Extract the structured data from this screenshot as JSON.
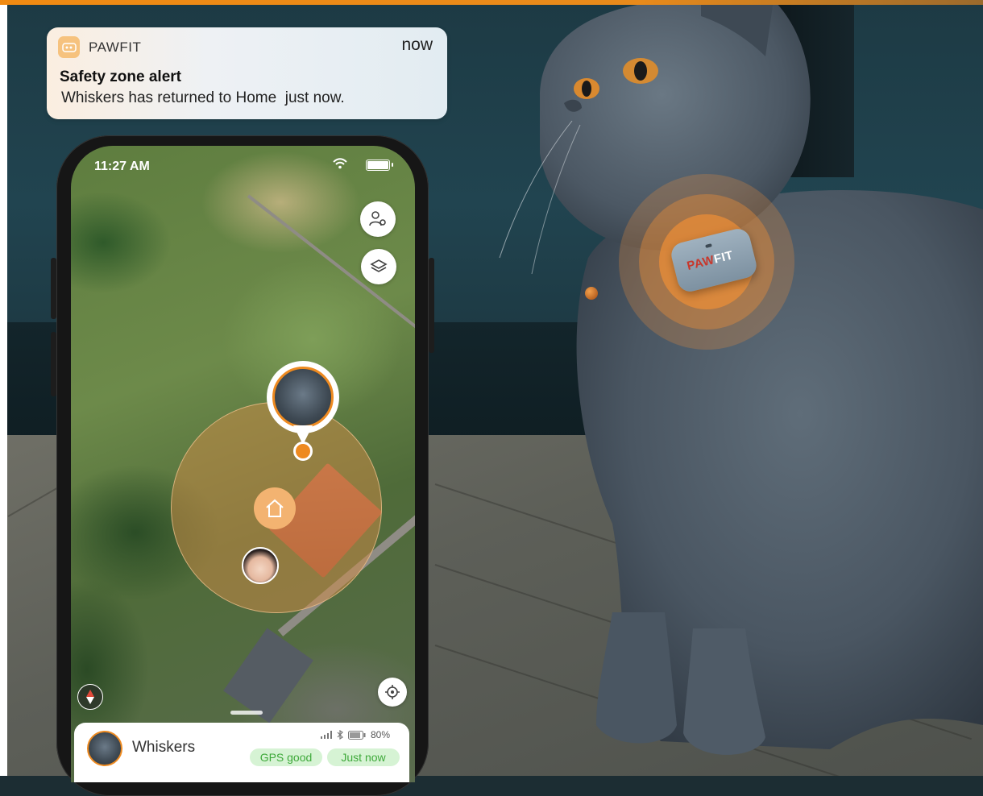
{
  "notification": {
    "app_name": "PAWFIT",
    "time": "now",
    "title": "Safety zone alert",
    "body": "Whiskers has returned to Home  just now."
  },
  "phone": {
    "status_bar": {
      "time": "11:27 AM"
    },
    "map_buttons": [
      "family-location-icon",
      "layers-icon",
      "locate-icon",
      "compass-icon"
    ],
    "pet_card": {
      "name": "Whiskers",
      "battery": "80%",
      "chips": [
        "GPS good",
        "Just now"
      ]
    }
  },
  "tracker": {
    "brand_left": "PAW",
    "brand_right": "FIT"
  },
  "colors": {
    "accent": "#ee8a20",
    "chip_bg": "#d6f3d4",
    "chip_text": "#3ea93a"
  }
}
